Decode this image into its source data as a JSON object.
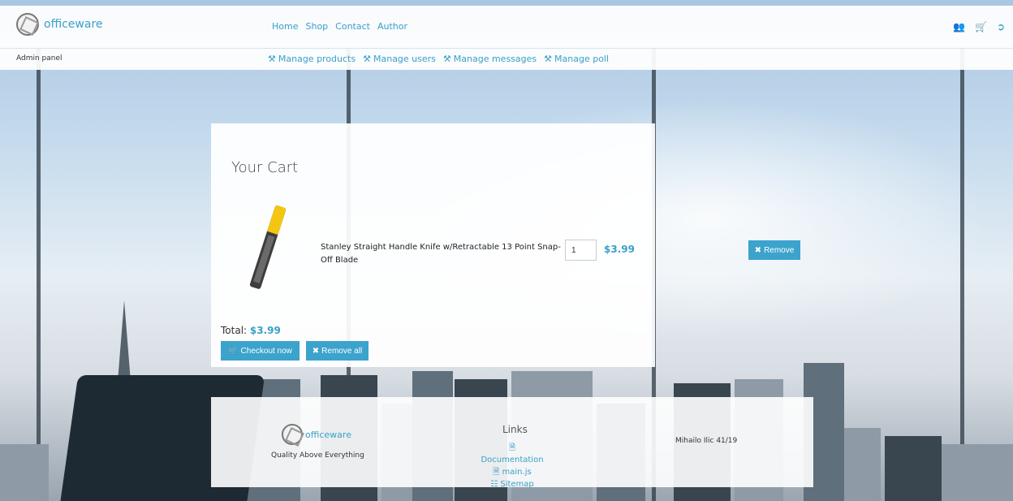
{
  "brand": {
    "name": "officeware"
  },
  "nav": [
    "Home",
    "Shop",
    "Contact",
    "Author"
  ],
  "top_icons": [
    "user-settings-icon",
    "cart-icon",
    "logout-icon"
  ],
  "admin": {
    "label": "Admin panel",
    "links": [
      "Manage products",
      "Manage users",
      "Manage messages",
      "Manage poll"
    ]
  },
  "cart": {
    "title": "Your Cart",
    "item": {
      "name": "Stanley Straight Handle Knife w/Retractable 13 Point Snap-Off Blade",
      "quantity": "1",
      "price": "$3.99",
      "remove_label": "Remove"
    },
    "total_label": "Total:",
    "total_value": "$3.99",
    "checkout_label": "Checkout now",
    "remove_all_label": "Remove all"
  },
  "footer": {
    "tagline": "Quality Above Everything",
    "links_title": "Links",
    "links": [
      "Documentation",
      "main.js",
      "Sitemap"
    ],
    "address": "Mihailo Ilic 41/19"
  },
  "colors": {
    "accent": "#3aa0c8",
    "button": "#3ba3cc"
  }
}
